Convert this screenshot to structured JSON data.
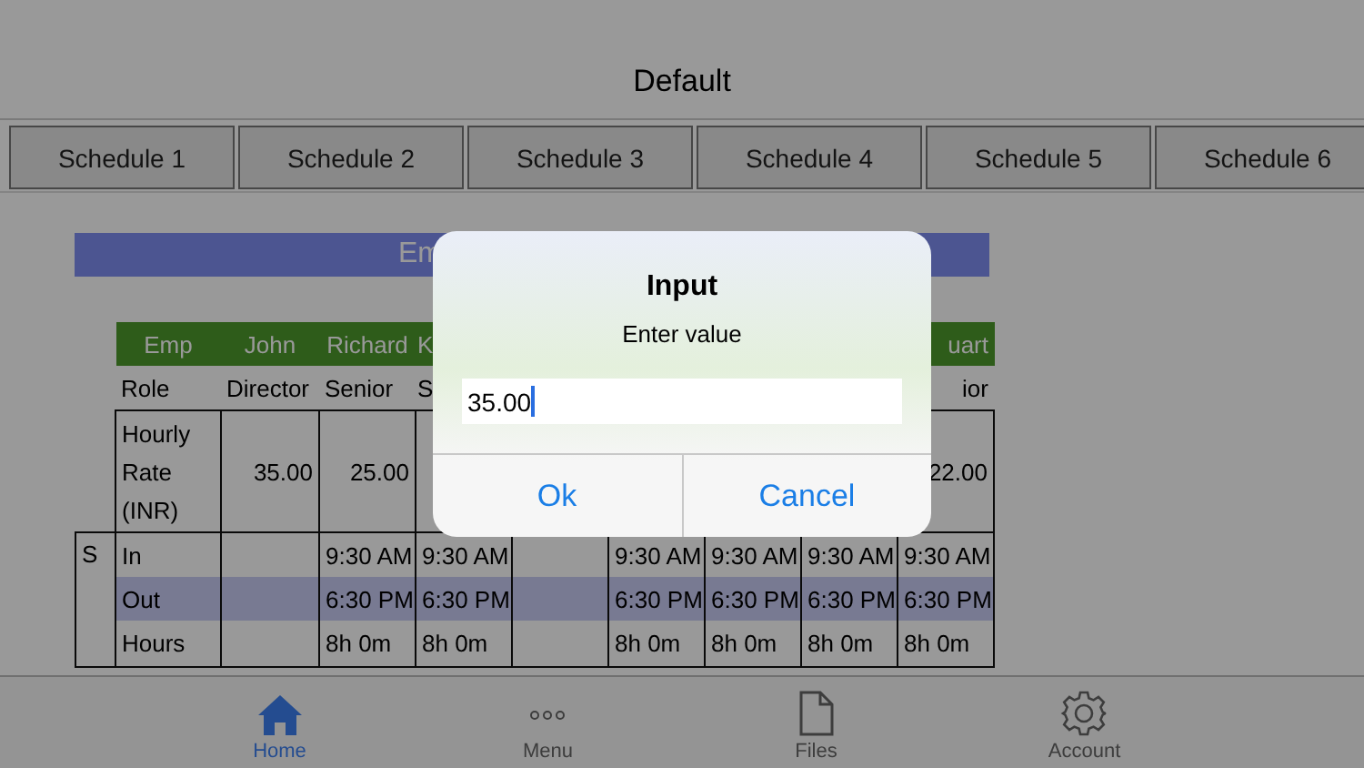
{
  "header": {
    "title": "Default"
  },
  "schedule_tabs": [
    "Schedule 1",
    "Schedule 2",
    "Schedule 3",
    "Schedule 4",
    "Schedule 5",
    "Schedule 6"
  ],
  "table": {
    "banner": "Em",
    "header": [
      "Emp",
      "John",
      "Richard",
      "K",
      "uart"
    ],
    "rows": [
      {
        "kind": "role",
        "cells": [
          "Role",
          "Director",
          "Senior",
          "S",
          "ior"
        ]
      },
      {
        "kind": "rate",
        "cells": [
          "Hourly Rate (INR)",
          "35.00",
          "25.00",
          "",
          "22.00"
        ]
      }
    ],
    "day_block": {
      "label": "S",
      "rows": [
        {
          "label": "In",
          "highlight": false,
          "cells": [
            {
              "kind": "empty"
            },
            {
              "kind": "text",
              "text": "9:30 AM"
            },
            {
              "kind": "text",
              "text": "9:30 AM"
            },
            {
              "kind": "empty"
            },
            {
              "kind": "text",
              "text": "9:30 AM"
            },
            {
              "kind": "text",
              "text": "9:30 AM"
            },
            {
              "kind": "text",
              "text": "9:30 AM"
            },
            {
              "kind": "text",
              "text": "9:30 AM"
            }
          ]
        },
        {
          "label": "Out",
          "highlight": true,
          "cells": [
            {
              "kind": "empty"
            },
            {
              "kind": "text",
              "text": "6:30 PM"
            },
            {
              "kind": "text",
              "text": "6:30 PM"
            },
            {
              "kind": "empty"
            },
            {
              "kind": "text",
              "text": "6:30 PM"
            },
            {
              "kind": "text",
              "text": "6:30 PM"
            },
            {
              "kind": "text",
              "text": "6:30 PM"
            },
            {
              "kind": "text",
              "text": "6:30 PM"
            }
          ]
        },
        {
          "label": "Hours",
          "highlight": false,
          "cells": [
            {
              "kind": "empty"
            },
            {
              "kind": "text",
              "text": "8h 0m"
            },
            {
              "kind": "text",
              "text": "8h 0m"
            },
            {
              "kind": "empty"
            },
            {
              "kind": "text",
              "text": "8h 0m"
            },
            {
              "kind": "text",
              "text": "8h 0m"
            },
            {
              "kind": "text",
              "text": "8h 0m"
            },
            {
              "kind": "text",
              "text": "8h 0m"
            }
          ]
        }
      ]
    }
  },
  "dialog": {
    "title": "Input",
    "message": "Enter value",
    "value": "35.00",
    "buttons": [
      "Ok",
      "Cancel"
    ]
  },
  "tab_bar": [
    {
      "kind": "home",
      "label": "Home",
      "selected": true
    },
    {
      "kind": "menu",
      "label": "Menu",
      "selected": false
    },
    {
      "kind": "files",
      "label": "Files",
      "selected": false
    },
    {
      "kind": "account",
      "label": "Account",
      "selected": false
    }
  ]
}
